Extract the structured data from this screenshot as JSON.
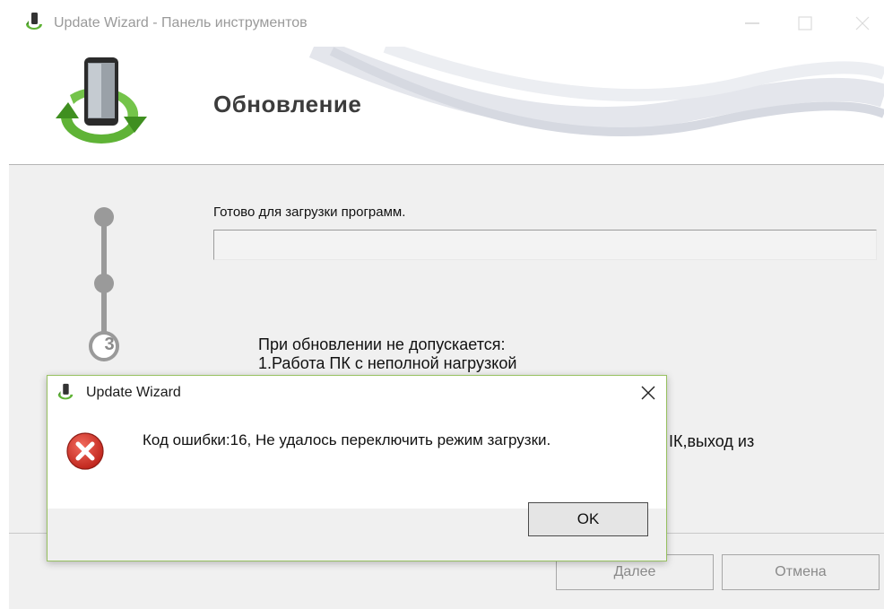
{
  "window": {
    "title": "Update Wizard - Панель инструментов",
    "icon": "app-phone-icon"
  },
  "header": {
    "title": "Обновление",
    "logo": "phone-refresh-logo"
  },
  "steps": {
    "current_step_label": "3"
  },
  "main": {
    "status_text": "Готово для загрузки программ.",
    "progress_value": 0,
    "warning_title": "При обновлении не допускается:",
    "warning_line1": "1.Работа ПК с неполной нагрузкой",
    "warning_tail": "ІК,выход из"
  },
  "footer": {
    "next_label": "Далее",
    "cancel_label": "Отмена"
  },
  "dialog": {
    "title": "Update Wizard",
    "message": "Код ошибки:16, Не удалось переключить режим загрузки.",
    "ok_label": "OK",
    "icon": "error-icon"
  },
  "colors": {
    "dialog_border": "#97c160",
    "error_red": "#d9332b",
    "logo_green": "#5fb336"
  }
}
